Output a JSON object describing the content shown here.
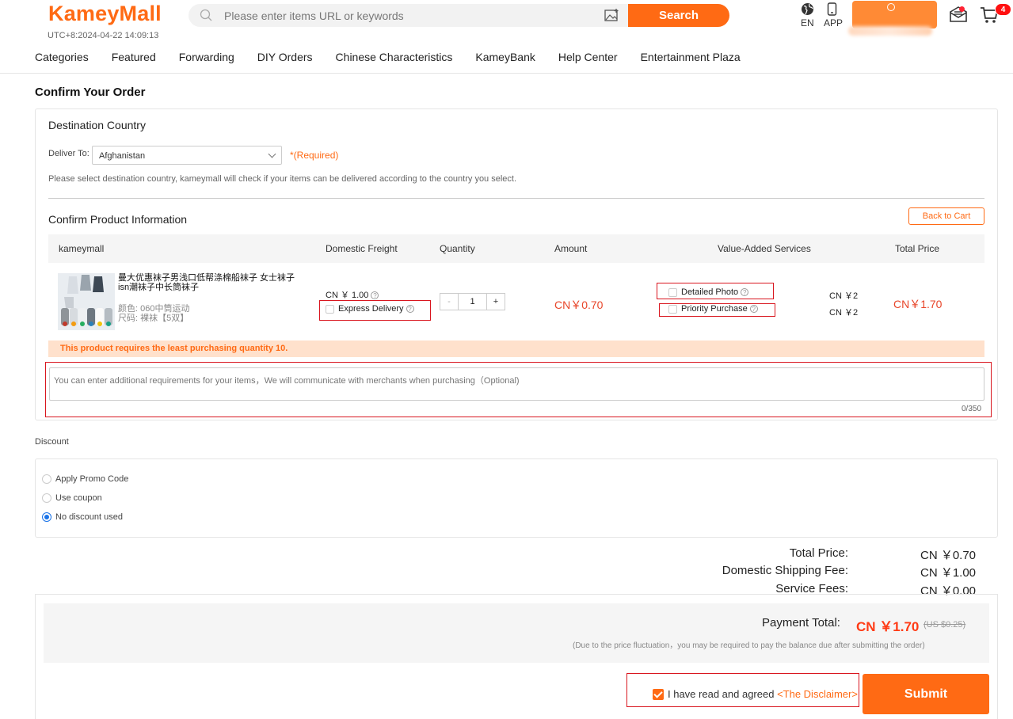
{
  "header": {
    "logo": "KameyMall",
    "clock": "UTC+8:2024-04-22 14:09:13",
    "search_placeholder": "Please enter items URL or keywords",
    "search_button": "Search",
    "lang": "EN",
    "app": "APP",
    "cart_count": "4"
  },
  "nav": [
    "Categories",
    "Featured",
    "Forwarding",
    "DIY Orders",
    "Chinese Characteristics",
    "KameyBank",
    "Help Center",
    "Entertainment Plaza"
  ],
  "page_title": "Confirm Your Order",
  "destination": {
    "title": "Destination Country",
    "deliver_label": "Deliver To:",
    "country": "Afghanistan",
    "required": "*(Required)",
    "hint": "Please select destination country, kameymall will check if your items can be delivered according to the country you select."
  },
  "product_info": {
    "title": "Confirm Product Information",
    "back_to_cart": "Back to Cart",
    "columns": [
      "kameymall",
      "Domestic Freight",
      "Quantity",
      "Amount",
      "Value-Added Services",
      "Total Price"
    ],
    "item": {
      "name": "曼大优惠袜子男浅口低帮涤棉船袜子 女士袜子isn潮袜子中长筒袜子",
      "color_attr": "颜色: 060中筒运动",
      "size_attr": "尺码: 裸袜【5双】",
      "freight": "CN ￥ 1.00",
      "express_delivery": "Express Delivery",
      "quantity": "1",
      "qty_minus": "-",
      "qty_plus": "+",
      "amount": "CN￥0.70",
      "services": [
        {
          "label": "Detailed Photo",
          "price": "CN ￥2"
        },
        {
          "label": "Priority Purchase",
          "price": "CN ￥2"
        }
      ],
      "total": "CN￥1.70"
    },
    "warning": "This product requires the least purchasing quantity 10.",
    "note_placeholder": "You can enter additional requirements for your items，We will communicate with merchants when purchasing（Optional)",
    "note_count": "0/350"
  },
  "discount": {
    "label": "Discount",
    "options": [
      "Apply Promo Code",
      "Use coupon",
      "No discount used"
    ],
    "selected": "No discount used"
  },
  "summary": {
    "total_price_label": "Total Price:",
    "total_price": "CN ￥0.70",
    "shipping_label": "Domestic Shipping Fee:",
    "shipping": "CN ￥1.00",
    "service_label": "Service Fees:",
    "service": "CN ￥0.00"
  },
  "payment": {
    "label": "Payment Total:",
    "total": "CN ￥1.70",
    "usd": "(US $0.25)",
    "note": "(Due to the price fluctuation，you may be required to pay the balance due after submitting the order)",
    "agree_text": "I have read and agreed",
    "disclaimer": "<The Disclaimer>",
    "submit": "Submit"
  },
  "colors": {
    "accent": "#ff6a14",
    "price_red": "#e8462a",
    "highlight_box": "#d9161f"
  }
}
